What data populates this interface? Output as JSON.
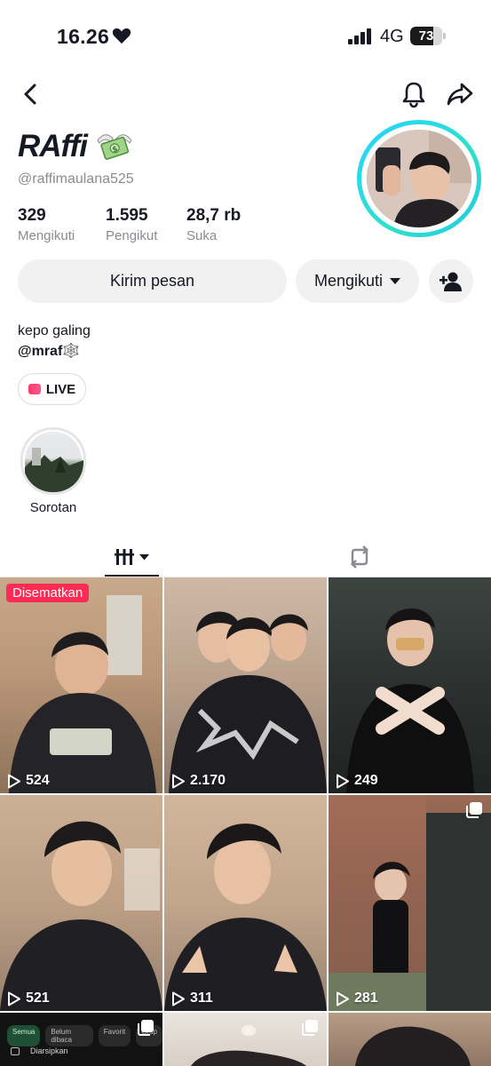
{
  "status_bar": {
    "time": "16.26",
    "network": "4G",
    "battery": "73",
    "battery_level": 0.73
  },
  "profile": {
    "display_name": "RAffi",
    "handle": "@raffimaulana525",
    "stats": [
      {
        "value": "329",
        "label": "Mengikuti"
      },
      {
        "value": "1.595",
        "label": "Pengikut"
      },
      {
        "value": "28,7 rb",
        "label": "Suka"
      }
    ],
    "bio": "kepo galing",
    "mention": "@mraf🕸️"
  },
  "actions": {
    "message_label": "Kirim pesan",
    "following_label": "Mengikuti"
  },
  "live_label": "LIVE",
  "highlight": {
    "label": "Sorotan"
  },
  "icons": {
    "back": "back-arrow-icon",
    "bell": "bell-icon",
    "share": "share-icon",
    "add_friend": "add-friend-icon",
    "videos_tab": "video-grid-icon",
    "reposts_tab": "repost-icon",
    "play": "play-icon"
  },
  "grid": {
    "pinned_label": "Disematkan",
    "videos": [
      {
        "views": "524"
      },
      {
        "views": "2.170"
      },
      {
        "views": "249"
      },
      {
        "views": "521"
      },
      {
        "views": "311"
      },
      {
        "views": "281"
      }
    ]
  },
  "chat_preview": {
    "filters": [
      "Semua",
      "Belum dibaca",
      "Favorit",
      "Grup"
    ],
    "archived_label": "Diarsipkan"
  },
  "colors": {
    "accent_pink": "#fe2c55",
    "ring": "#25d3ff",
    "button_bg": "#f1f1f2"
  }
}
